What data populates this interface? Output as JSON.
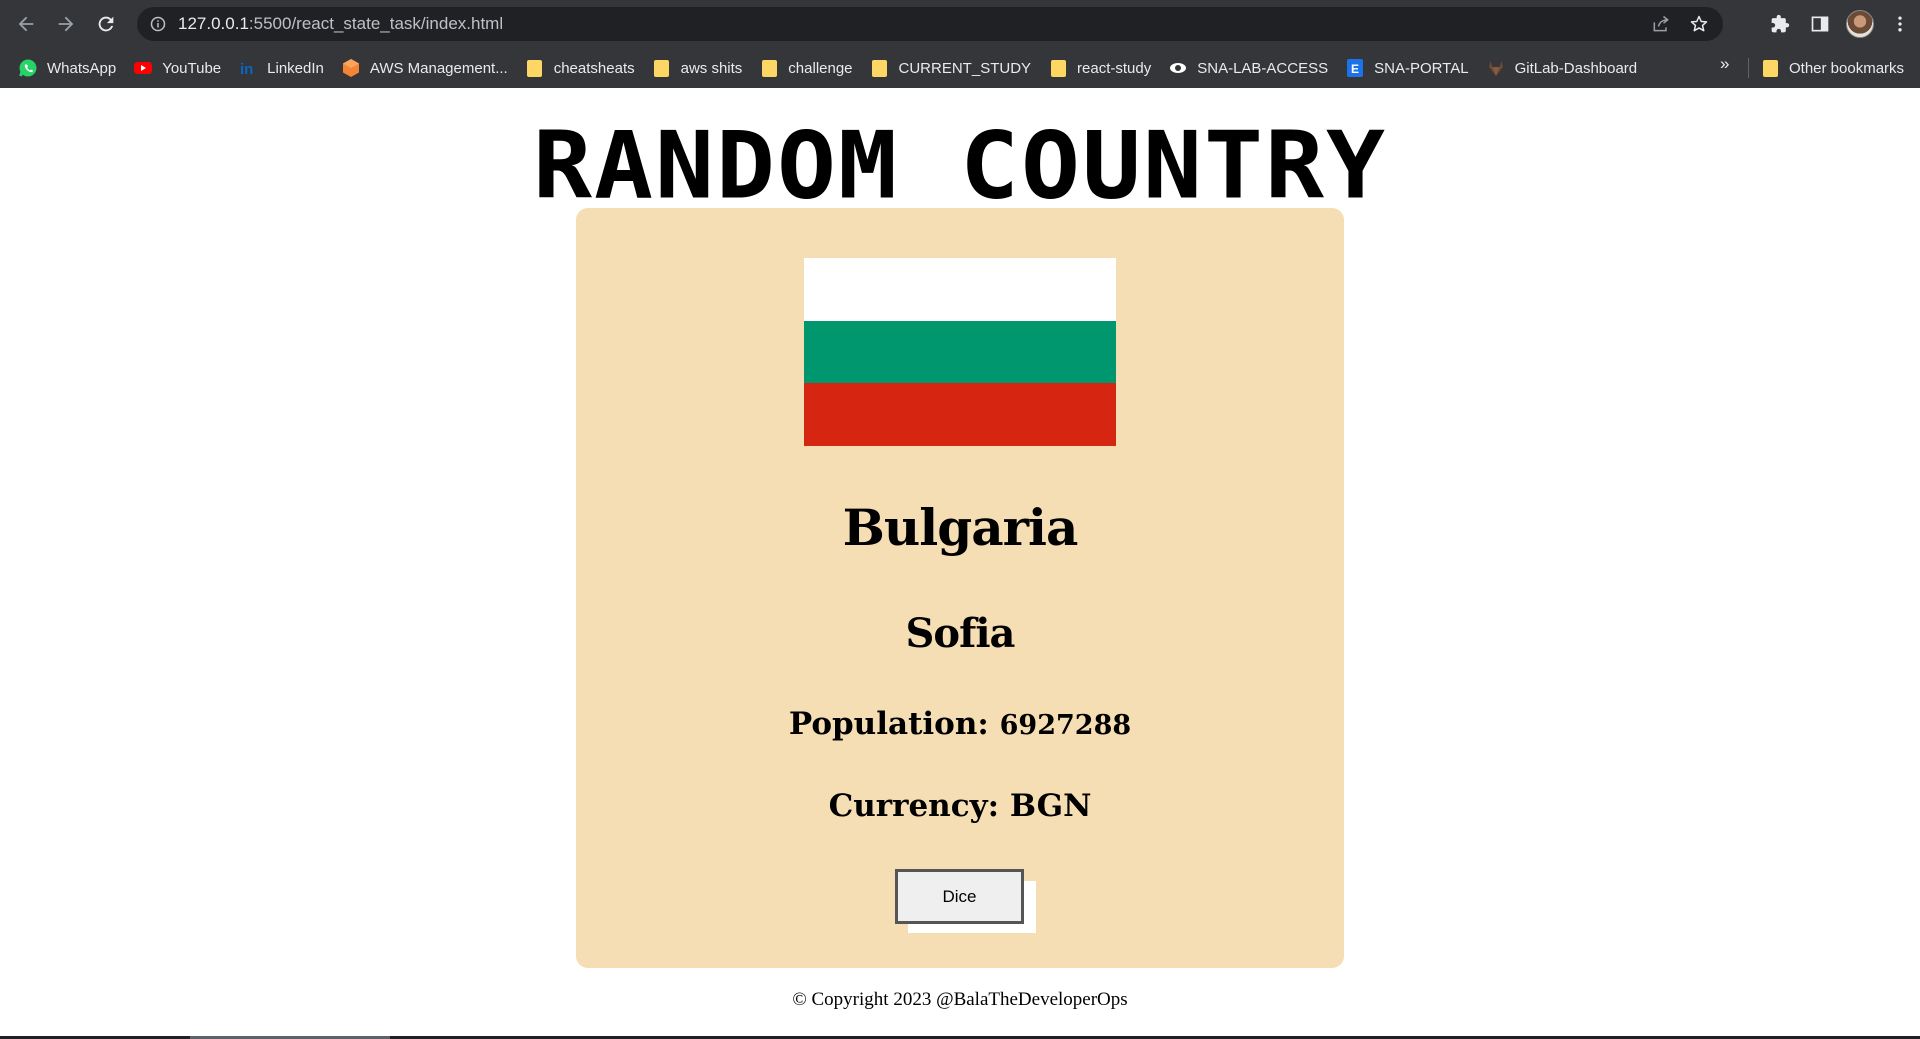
{
  "browser": {
    "url_host": "127.0.0.1",
    "url_rest": ":5500/react_state_task/index.html",
    "bookmarks": [
      {
        "label": "WhatsApp",
        "icon": "whatsapp-icon"
      },
      {
        "label": "YouTube",
        "icon": "youtube-icon"
      },
      {
        "label": "LinkedIn",
        "icon": "linkedin-icon"
      },
      {
        "label": "AWS Management...",
        "icon": "aws-icon"
      },
      {
        "label": "cheatsheats",
        "icon": "folder-icon"
      },
      {
        "label": "aws shits",
        "icon": "folder-icon"
      },
      {
        "label": "challenge",
        "icon": "folder-icon"
      },
      {
        "label": "CURRENT_STUDY",
        "icon": "folder-icon"
      },
      {
        "label": "react-study",
        "icon": "folder-icon"
      },
      {
        "label": "SNA-LAB-ACCESS",
        "icon": "eye-icon"
      },
      {
        "label": "SNA-PORTAL",
        "icon": "e-icon"
      },
      {
        "label": "GitLab-Dashboard",
        "icon": "gitlab-icon"
      }
    ],
    "more_label": "»",
    "other_bookmarks": "Other bookmarks"
  },
  "page": {
    "title": "RANDOM COUNTRY",
    "country": "Bulgaria",
    "capital": "Sofia",
    "population_label": "Population:",
    "population_value": "6927288",
    "currency_label": "Currency:",
    "currency_value": "BGN",
    "dice_label": "Dice",
    "footer": "© Copyright 2023 @BalaTheDeveloperOps"
  },
  "flag_colors": [
    "#ffffff",
    "#00966e",
    "#d62612"
  ]
}
